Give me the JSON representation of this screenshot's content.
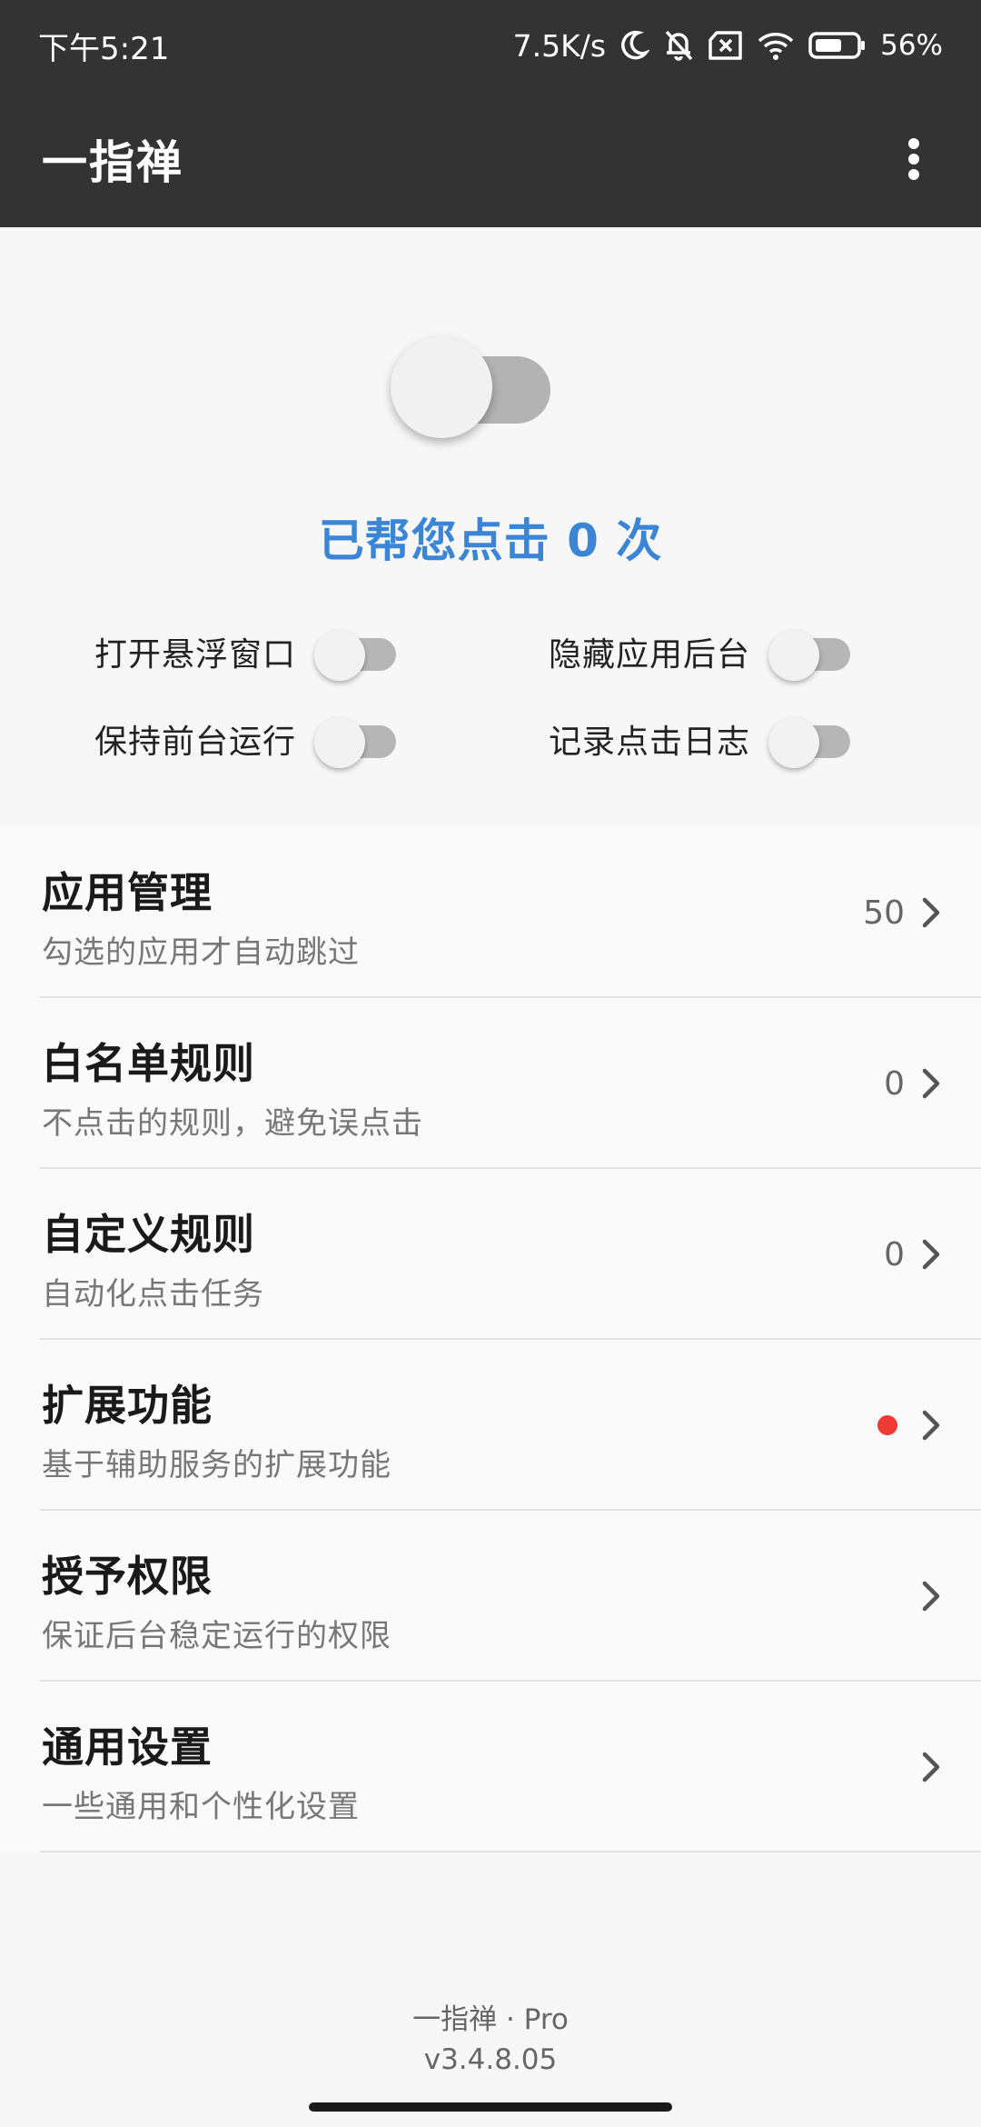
{
  "status_bar": {
    "time": "下午5:21",
    "net_speed": "7.5K/s",
    "battery": "56%",
    "icons": [
      "moon-icon",
      "bell-off-icon",
      "sim-error-icon",
      "wifi-icon",
      "battery-icon"
    ]
  },
  "app_bar": {
    "title": "一指禅",
    "menu_icon": "more-vertical-icon"
  },
  "main_toggle": {
    "on": false
  },
  "clicks_text": "已帮您点击 0 次",
  "options": [
    {
      "label": "打开悬浮窗口",
      "on": false
    },
    {
      "label": "隐藏应用后台",
      "on": false
    },
    {
      "label": "保持前台运行",
      "on": false
    },
    {
      "label": "记录点击日志",
      "on": false
    }
  ],
  "menu": [
    {
      "title": "应用管理",
      "subtitle": "勾选的应用才自动跳过",
      "count": "50"
    },
    {
      "title": "白名单规则",
      "subtitle": "不点击的规则，避免误点击",
      "count": "0"
    },
    {
      "title": "自定义规则",
      "subtitle": "自动化点击任务",
      "count": "0"
    },
    {
      "title": "扩展功能",
      "subtitle": "基于辅助服务的扩展功能",
      "count": "",
      "dot": true
    },
    {
      "title": "授予权限",
      "subtitle": "保证后台稳定运行的权限",
      "count": ""
    },
    {
      "title": "通用设置",
      "subtitle": "一些通用和个性化设置",
      "count": ""
    }
  ],
  "footer": {
    "app_line": "一指禅 · Pro",
    "version": "v3.4.8.05"
  },
  "colors": {
    "bar_bg": "#333333",
    "accent_blue": "#3a85d6",
    "red_dot": "#ef3b36"
  }
}
